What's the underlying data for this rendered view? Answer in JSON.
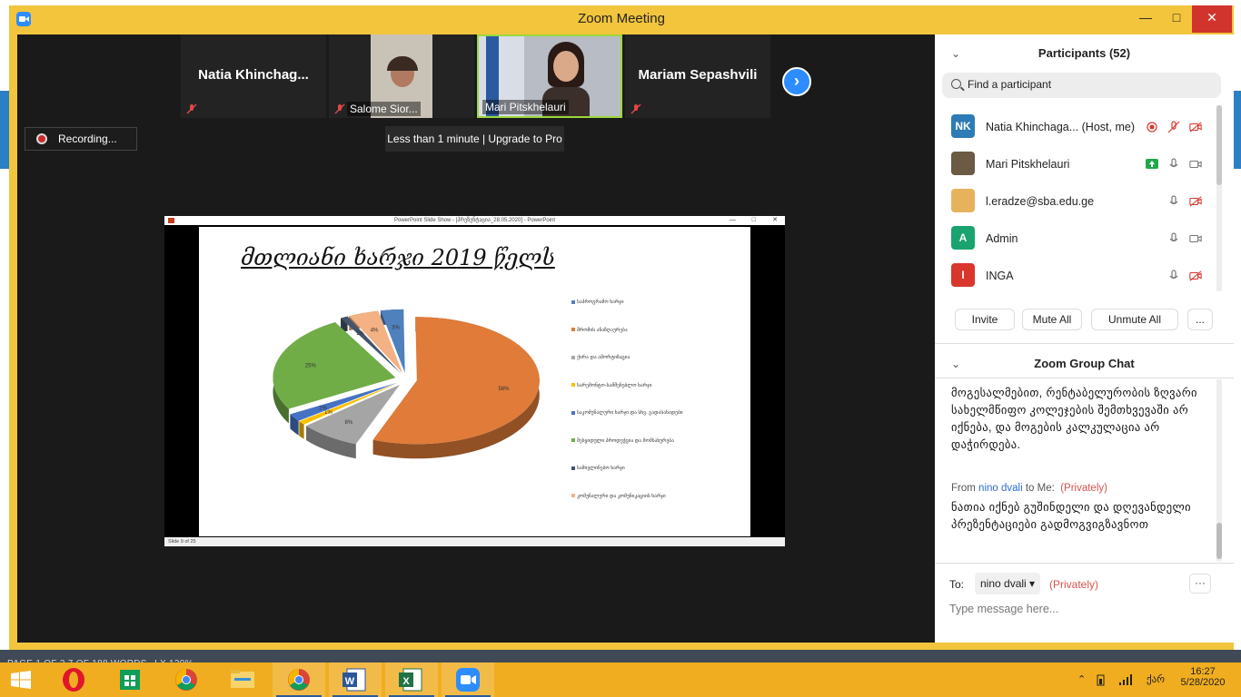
{
  "window": {
    "title": "Zoom Meeting",
    "minimize": "—",
    "maximize": "□",
    "close": "✕"
  },
  "gallery": {
    "tiles": [
      {
        "name": "Natia  Khinchag...",
        "mic": "muted"
      },
      {
        "name": "Salome Sior...",
        "mic": "muted"
      },
      {
        "name": "Mari Pitskhelauri",
        "active_speaker": true
      },
      {
        "name": "Mariam Sepashvili",
        "mic": "muted"
      }
    ],
    "next": "›"
  },
  "recording": {
    "label": "Recording..."
  },
  "upgrade_banner": "Less than 1 minute | Upgrade to Pro",
  "ppt": {
    "window_title": "PowerPoint Slide Show - [პრეზენტაცია_28.05.2020] - PowerPoint",
    "status": "Slide 9 of 25",
    "slide_title": "მთლიანი ხარჯი  2019 წელს"
  },
  "chart_data": {
    "type": "pie",
    "title": "მთლიანი ხარჯი  2019 წელს",
    "slices": [
      {
        "label": "საპროგრამო ხარჯი",
        "value": 3,
        "data_label": "3%",
        "color": "#4f81bd"
      },
      {
        "label": "შრომის ანაზღაურება",
        "value": 56,
        "data_label": "56%",
        "color": "#e07b39"
      },
      {
        "label": "ქირა და ამორტიზაცია",
        "value": 8,
        "data_label": "8%",
        "color": "#a5a5a5"
      },
      {
        "label": "სარემონტო-სამშენებლო ხარჯი",
        "value": 1,
        "data_label": "1%",
        "color": "#ffc000"
      },
      {
        "label": "საკომუნალური ხარჯი და სხვ. გადასახადები",
        "value": 2,
        "data_label": "2%",
        "color": "#4472c4"
      },
      {
        "label": "შესყიდული პროდუქცია და მომსახურება",
        "value": 25,
        "data_label": "25%",
        "color": "#70ad47"
      },
      {
        "label": "სამივლინებო ხარჯი",
        "value": 1,
        "data_label": "1%",
        "color": "#44546a"
      },
      {
        "label": "კომუნალური და კომუნიკაციის ხარჯი",
        "value": 4,
        "data_label": "4%",
        "color": "#f4b183"
      }
    ],
    "legend_position": "right"
  },
  "participants": {
    "header": "Participants (52)",
    "search_placeholder": "Find a participant",
    "list": [
      {
        "initials": "NK",
        "name": "Natia Khinchaga...",
        "tag": "(Host, me)",
        "color": "#2e7bb5"
      },
      {
        "initials": "",
        "name": "Mari Pitskhelauri",
        "tag": "",
        "color": "#6b5a44"
      },
      {
        "initials": "",
        "name": "l.eradze@sba.edu.ge",
        "tag": "",
        "color": "#e6b35c"
      },
      {
        "initials": "A",
        "name": "Admin",
        "tag": "",
        "color": "#1aa36e"
      },
      {
        "initials": "I",
        "name": "INGA",
        "tag": "",
        "color": "#d9362c"
      }
    ],
    "buttons": {
      "invite": "Invite",
      "mute_all": "Mute All",
      "unmute_all": "Unmute All",
      "more": "..."
    }
  },
  "chat": {
    "header": "Zoom Group Chat",
    "message1": "მოგესალმებით, რენტაბელურობის ზღვარი სახელმწიფო კოლეჯების შემთხვევაში არ იქნება, და მოგების კალკულაცია არ დაჭირდება.",
    "from_prefix": "From",
    "from_name": "nino dvali",
    "from_to": "to Me:",
    "privately": "(Privately)",
    "message2": "ნათია იქნებ გუშინდელი და დღევანდელი პრეზენტაციები გადმოგვიგზავნოთ",
    "to_label": "To:",
    "to_value": "nino dvali",
    "input_placeholder": "Type message here..."
  },
  "behind_window_text": "PAGE 1 OF 2      7 OF 188 WORDS      LX                                                     130%",
  "taskbar": {
    "apps": [
      "opera",
      "store",
      "chrome",
      "file-explorer",
      "chrome",
      "word",
      "excel",
      "zoom"
    ],
    "language": "ქარ",
    "time": "16:27",
    "date": "5/28/2020"
  }
}
